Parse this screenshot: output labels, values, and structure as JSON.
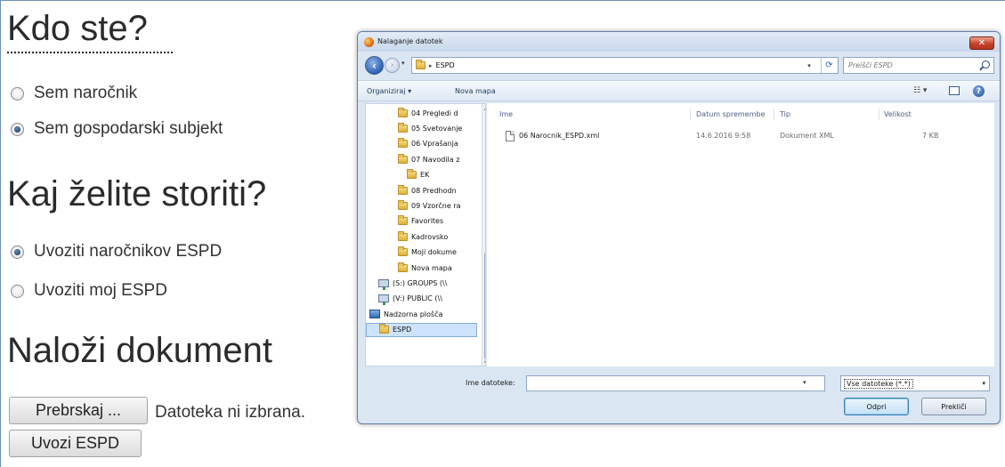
{
  "form": {
    "who_heading": "Kdo ste?",
    "who_options": [
      {
        "label": "Sem naročnik",
        "checked": false
      },
      {
        "label": "Sem gospodarski subjekt",
        "checked": true
      }
    ],
    "action_heading": "Kaj želite storiti?",
    "action_options": [
      {
        "label": "Uvoziti naročnikov ESPD",
        "checked": true
      },
      {
        "label": "Uvoziti moj ESPD",
        "checked": false
      }
    ],
    "upload_heading": "Naloži dokument",
    "browse_label": "Prebrskaj ...",
    "no_file_text": "Datoteka ni izbrana.",
    "import_label": "Uvozi ESPD"
  },
  "dialog": {
    "title": "Nalaganje datotek",
    "close_label": "✕",
    "address_sep": "▸",
    "address_folder": "ESPD",
    "search_placeholder": "Preišči ESPD",
    "toolbar": {
      "organize": "Organiziraj ▾",
      "new_folder": "Nova mapa",
      "view": "☷ ▾",
      "help": "?"
    },
    "tree": [
      {
        "label": "04 Pregledi d",
        "type": "folder",
        "indent": 1
      },
      {
        "label": "05 Svetovanje",
        "type": "folder",
        "indent": 1
      },
      {
        "label": "06 Vprašanja",
        "type": "folder",
        "indent": 1
      },
      {
        "label": "07 Navodila z",
        "type": "folder",
        "indent": 1
      },
      {
        "label": "EK",
        "type": "folder",
        "indent": 2
      },
      {
        "label": "08 Predhodn",
        "type": "folder",
        "indent": 1
      },
      {
        "label": "09 Vzorčne ra",
        "type": "folder",
        "indent": 1
      },
      {
        "label": "Favorites",
        "type": "folder",
        "indent": 1
      },
      {
        "label": "Kadrovsko",
        "type": "folder",
        "indent": 1
      },
      {
        "label": "Moji dokume",
        "type": "folder",
        "indent": 1
      },
      {
        "label": "Nova mapa",
        "type": "folder",
        "indent": 1
      },
      {
        "label": "(S:) GROUPS (\\\\",
        "type": "net",
        "indent": 0
      },
      {
        "label": "(V:) PUBLIC (\\\\",
        "type": "net",
        "indent": 0
      },
      {
        "label": "Nadzorna plošča",
        "type": "cp",
        "indent": -1
      },
      {
        "label": "ESPD",
        "type": "folder",
        "indent": 0,
        "selected": true
      }
    ],
    "columns": {
      "name": "Ime",
      "date": "Datum spremembe",
      "type": "Tip",
      "size": "Velikost"
    },
    "files": [
      {
        "name": "06 Narocnik_ESPD.xml",
        "date": "14.6.2016 9:58",
        "type": "Dokument XML",
        "size": "7 KB"
      }
    ],
    "filename_label": "Ime datoteke:",
    "filename_value": "",
    "filter_value": "Vse datoteke (*.*)",
    "open_label": "Odpri",
    "cancel_label": "Prekliči"
  }
}
